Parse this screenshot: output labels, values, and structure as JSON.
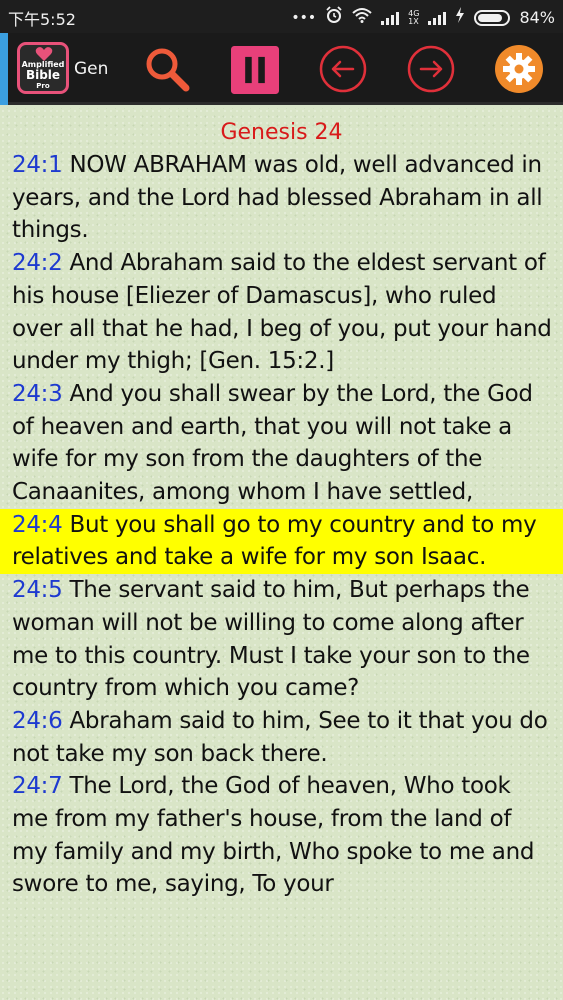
{
  "status_bar": {
    "time": "下午5:52",
    "dots": "•••",
    "network_type": "4G",
    "network_sub": "1X",
    "battery_percent": "84%",
    "battery_level": 0.84
  },
  "toolbar": {
    "logo": {
      "line1": "Amplified",
      "line2": "Bible",
      "line3": "Pro"
    },
    "book_abbrev": "Gen",
    "colors": {
      "search": "#ee5a3a",
      "pause": "#e8407a",
      "nav_circle": "#e0303a",
      "settings": "#f08a2a"
    }
  },
  "reader": {
    "chapter_title": "Genesis 24",
    "verses": [
      {
        "ref": "24:1",
        "text": "NOW ABRAHAM was old, well advanced in years, and the Lord had blessed Abraham in all things.",
        "highlighted": false
      },
      {
        "ref": "24:2",
        "text": "And Abraham said to the eldest servant of his house [Eliezer of Damascus], who ruled over all that he had, I beg of you, put your hand under my thigh; [Gen. 15:2.]",
        "highlighted": false
      },
      {
        "ref": "24:3",
        "text": "And you shall swear by the Lord, the God of heaven and earth, that you will not take a wife for my son from the daughters of the Canaanites, among whom I have settled,",
        "highlighted": false
      },
      {
        "ref": "24:4",
        "text": "But you shall go to my country and to my relatives and take a wife for my son Isaac.",
        "highlighted": true
      },
      {
        "ref": "24:5",
        "text": "The servant said to him, But perhaps the woman will not be willing to come along after me to this country. Must I take your son to the country from which you came?",
        "highlighted": false
      },
      {
        "ref": "24:6",
        "text": "Abraham said to him, See to it that you do not take my son back there.",
        "highlighted": false
      },
      {
        "ref": "24:7",
        "text": "The Lord, the God of heaven, Who took me from my father's house, from the land of my family and my birth, Who spoke to me and swore to me, saying, To your",
        "highlighted": false
      }
    ]
  }
}
